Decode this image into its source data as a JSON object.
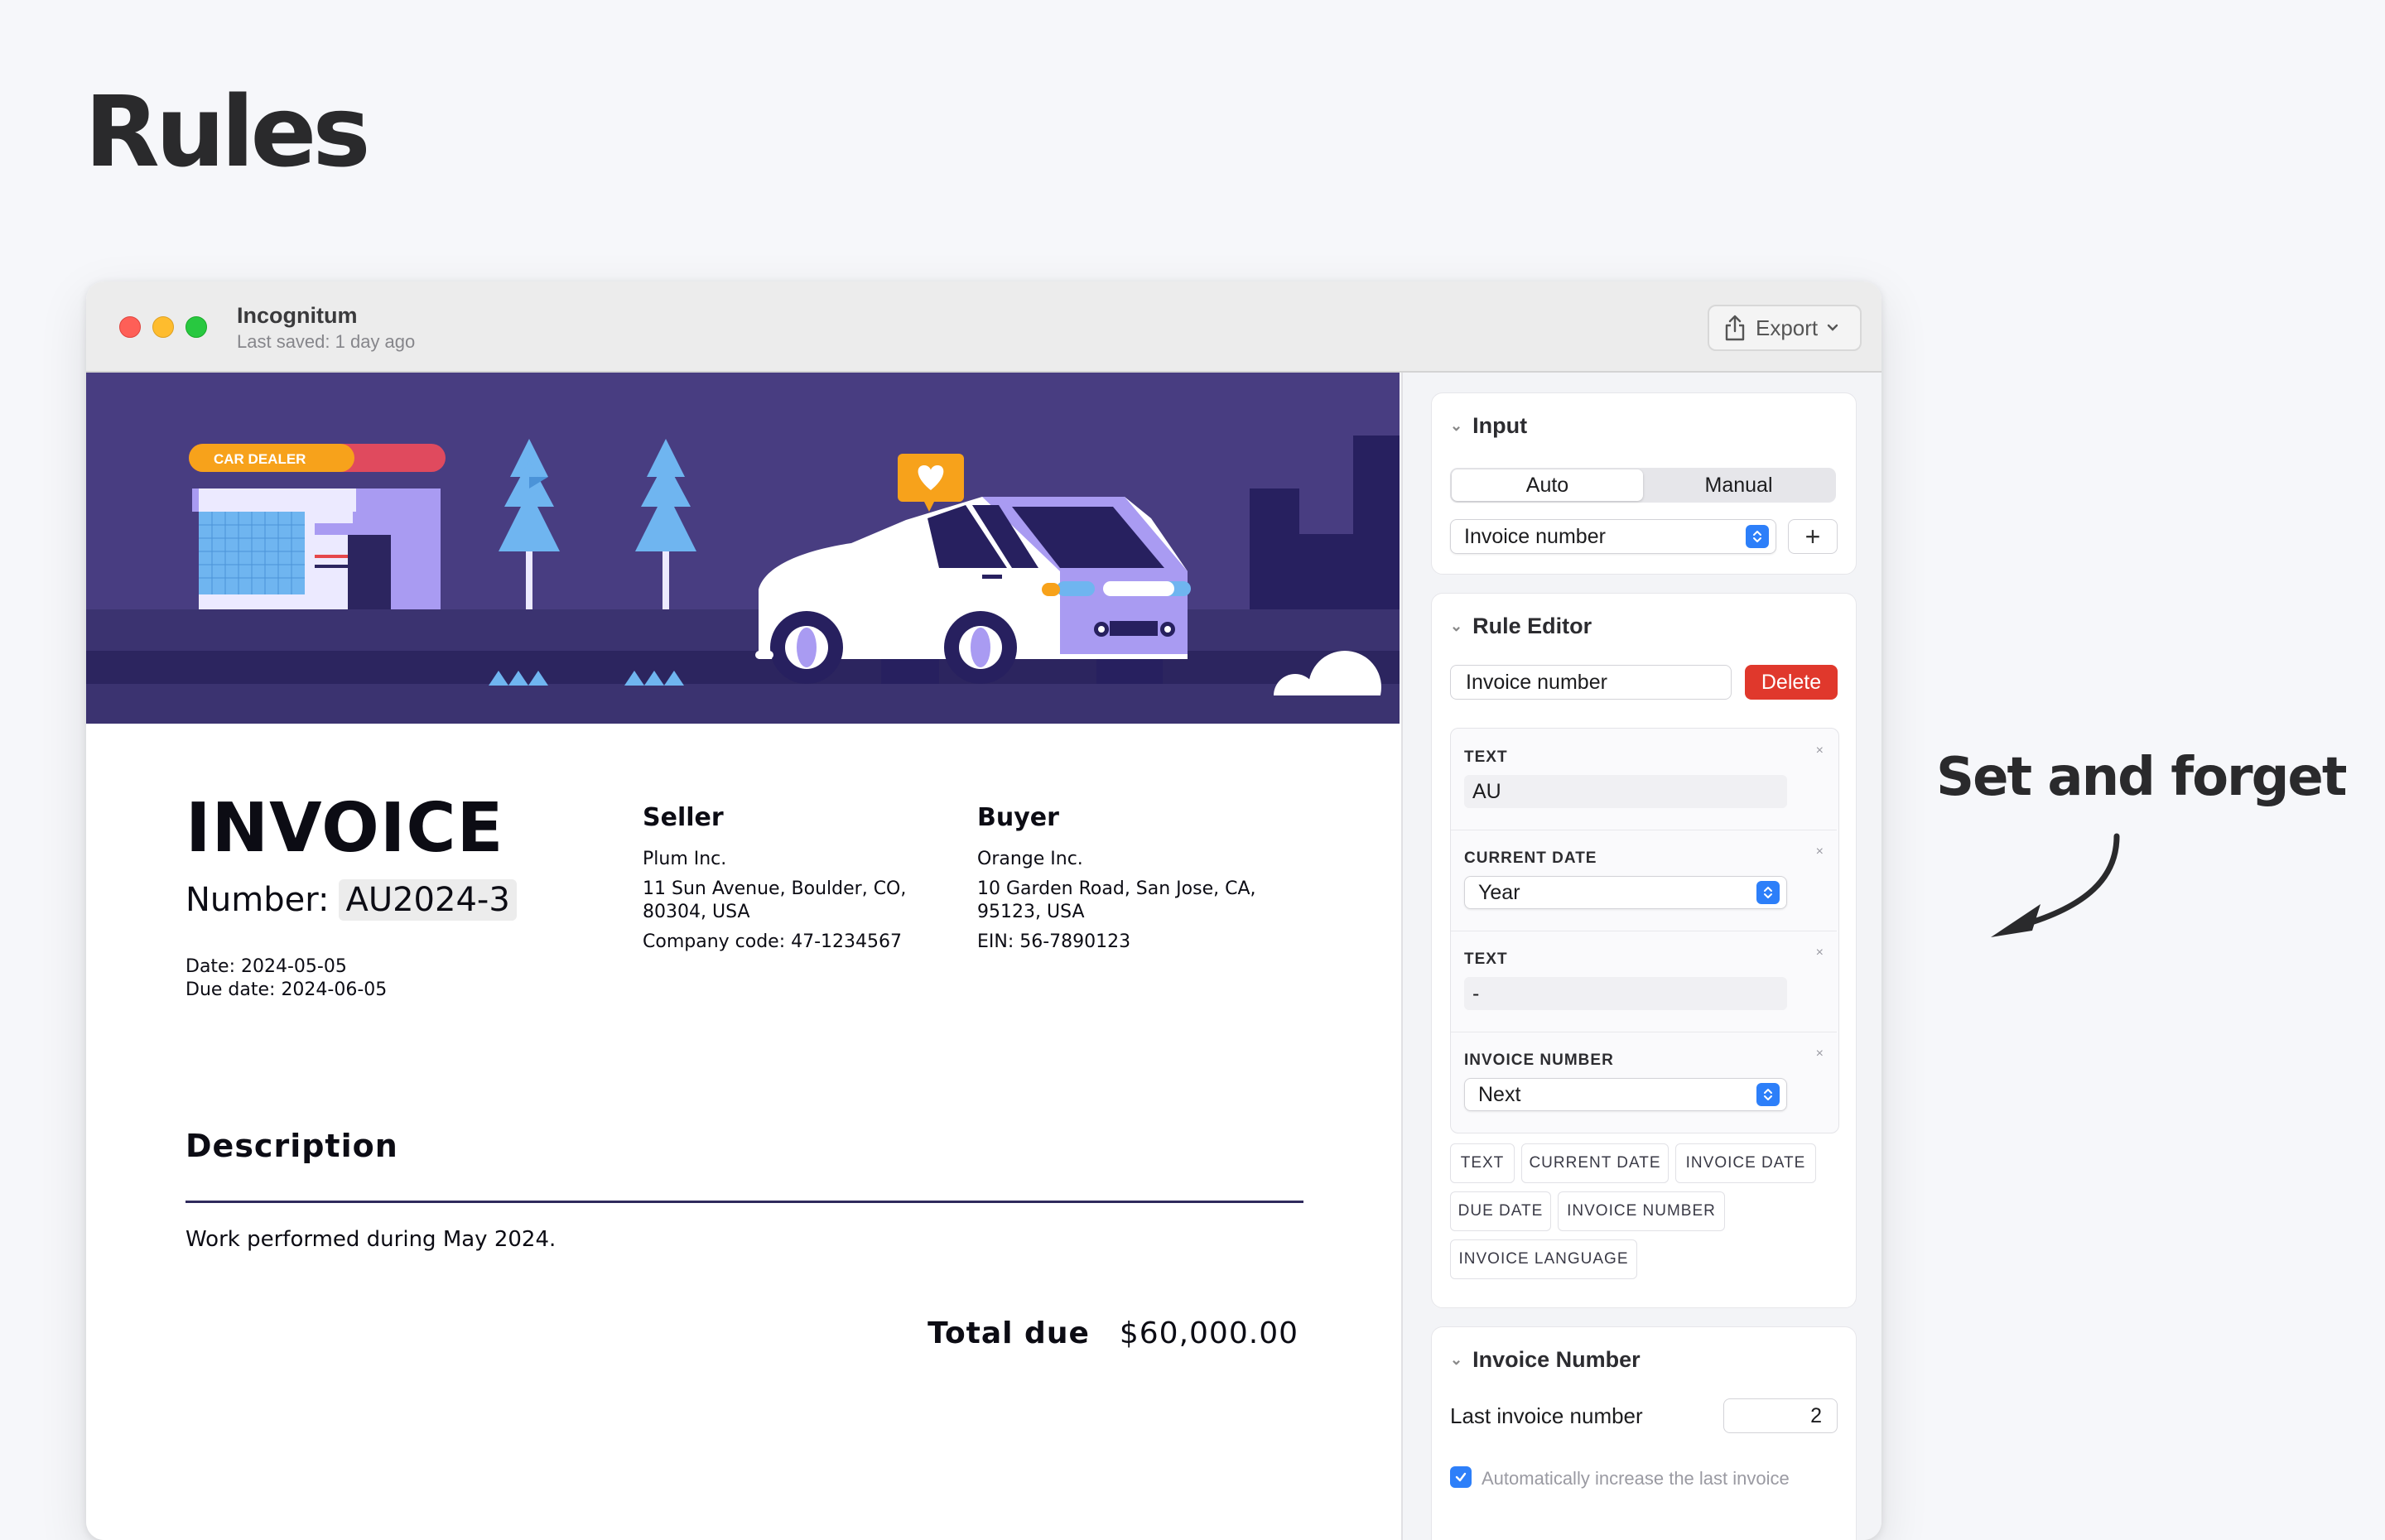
{
  "hero": {
    "title": "Rules",
    "tagline": "Set and forget"
  },
  "window": {
    "app_title": "Incognitum",
    "last_saved": "Last saved: 1 day ago",
    "export_label": "Export"
  },
  "banner": {
    "sign_text": "CAR DEALER"
  },
  "invoice": {
    "title": "INVOICE",
    "number_label": "Number:",
    "number_value": "AU2024-3",
    "date_label": "Date:",
    "date_value": "2024-05-05",
    "due_label": "Due date:",
    "due_value": "2024-06-05",
    "seller": {
      "heading": "Seller",
      "name": "Plum Inc.",
      "address": "11 Sun Avenue, Boulder, CO, 80304, USA",
      "code": "Company code: 47-1234567"
    },
    "buyer": {
      "heading": "Buyer",
      "name": "Orange Inc.",
      "address": "10 Garden Road, San Jose, CA, 95123, USA",
      "code": "EIN: 56-7890123"
    },
    "description_heading": "Description",
    "description_text": "Work performed during May 2024.",
    "total_label": "Total due",
    "total_value": "$60,000.00"
  },
  "sidebar": {
    "input": {
      "heading": "Input",
      "modes": [
        "Auto",
        "Manual"
      ],
      "selected_mode": "Auto",
      "field_select": "Invoice number",
      "add_label": "+"
    },
    "rule_editor": {
      "heading": "Rule Editor",
      "rule_name": "Invoice number",
      "delete_label": "Delete",
      "tokens": [
        {
          "label": "TEXT",
          "value": "AU",
          "kind": "text"
        },
        {
          "label": "CURRENT DATE",
          "value": "Year",
          "kind": "select"
        },
        {
          "label": "TEXT",
          "value": "-",
          "kind": "text"
        },
        {
          "label": "INVOICE NUMBER",
          "value": "Next",
          "kind": "select"
        }
      ],
      "remove_label": "×",
      "chips": [
        "TEXT",
        "CURRENT DATE",
        "INVOICE DATE",
        "DUE DATE",
        "INVOICE NUMBER",
        "INVOICE LANGUAGE"
      ]
    },
    "invoice_number": {
      "heading": "Invoice Number",
      "last_label": "Last invoice number",
      "last_value": "2",
      "auto_increase_label": "Automatically increase the last invoice"
    }
  },
  "colors": {
    "banner": "#483d81",
    "accent_blue": "#2d7ff9",
    "delete_red": "#e0382c",
    "sign_orange": "#f7a21b",
    "car_lilac": "#a99bf2"
  }
}
